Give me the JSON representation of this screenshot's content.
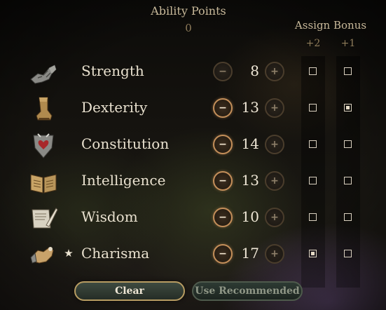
{
  "header": {
    "ability_points_label": "Ability Points",
    "ability_points_value": "0",
    "assign_bonus_label": "Assign Bonus",
    "plus2_label": "+2",
    "plus1_label": "+1"
  },
  "abilities": [
    {
      "name": "Strength",
      "value": "8",
      "icon": "gauntlet-icon",
      "star": "",
      "plus2": false,
      "plus1": false,
      "minus": "−",
      "plus": "+"
    },
    {
      "name": "Dexterity",
      "value": "13",
      "icon": "boot-icon",
      "star": "",
      "plus2": false,
      "plus1": true,
      "minus": "−",
      "plus": "+"
    },
    {
      "name": "Constitution",
      "value": "14",
      "icon": "heart-shield-icon",
      "star": "",
      "plus2": false,
      "plus1": false,
      "minus": "−",
      "plus": "+"
    },
    {
      "name": "Intelligence",
      "value": "13",
      "icon": "open-book-icon",
      "star": "",
      "plus2": false,
      "plus1": false,
      "minus": "−",
      "plus": "+"
    },
    {
      "name": "Wisdom",
      "value": "10",
      "icon": "scroll-quill-icon",
      "star": "",
      "plus2": false,
      "plus1": false,
      "minus": "−",
      "plus": "+"
    },
    {
      "name": "Charisma",
      "value": "17",
      "icon": "hand-icon",
      "star": "★",
      "plus2": true,
      "plus1": false,
      "minus": "−",
      "plus": "+"
    }
  ],
  "footer": {
    "clear_label": "Clear",
    "recommended_label": "Use Recommended"
  },
  "colors": {
    "accent": "#c48f5a",
    "text": "#e9e1cf",
    "muted": "#8f7c5a"
  }
}
